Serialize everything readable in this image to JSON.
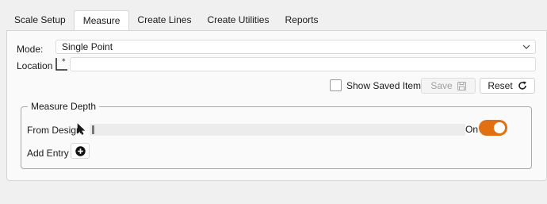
{
  "tabs": [
    {
      "label": "Scale Setup",
      "active": false
    },
    {
      "label": "Measure",
      "active": true
    },
    {
      "label": "Create Lines",
      "active": false
    },
    {
      "label": "Create Utilities",
      "active": false
    },
    {
      "label": "Reports",
      "active": false
    }
  ],
  "mode": {
    "label": "Mode:",
    "value": "Single Point"
  },
  "location": {
    "label": "Location",
    "value": ""
  },
  "show_saved": {
    "label": "Show Saved Items",
    "checked": false
  },
  "save_button": {
    "label": "Save",
    "enabled": false
  },
  "reset_button": {
    "label": "Reset"
  },
  "measure_depth": {
    "title": "Measure Depth",
    "from_design_label": "From Design:",
    "from_design_value": "",
    "toggle_label": "On",
    "toggle_on": true,
    "add_entry_label": "Add Entry"
  },
  "colors": {
    "accent": "#e07012"
  }
}
